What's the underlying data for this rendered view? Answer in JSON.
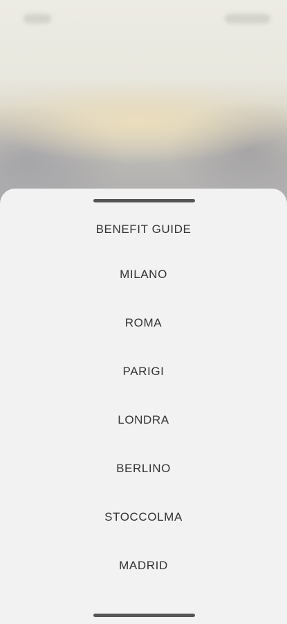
{
  "menu": {
    "items": [
      {
        "label": "BENEFIT GUIDE"
      },
      {
        "label": "MILANO"
      },
      {
        "label": "ROMA"
      },
      {
        "label": "PARIGI"
      },
      {
        "label": "LONDRA"
      },
      {
        "label": "BERLINO"
      },
      {
        "label": "STOCCOLMA"
      },
      {
        "label": "MADRID"
      }
    ]
  },
  "colors": {
    "sheet_background": "#f2f2f2",
    "text": "#333333",
    "handle": "#555555"
  }
}
